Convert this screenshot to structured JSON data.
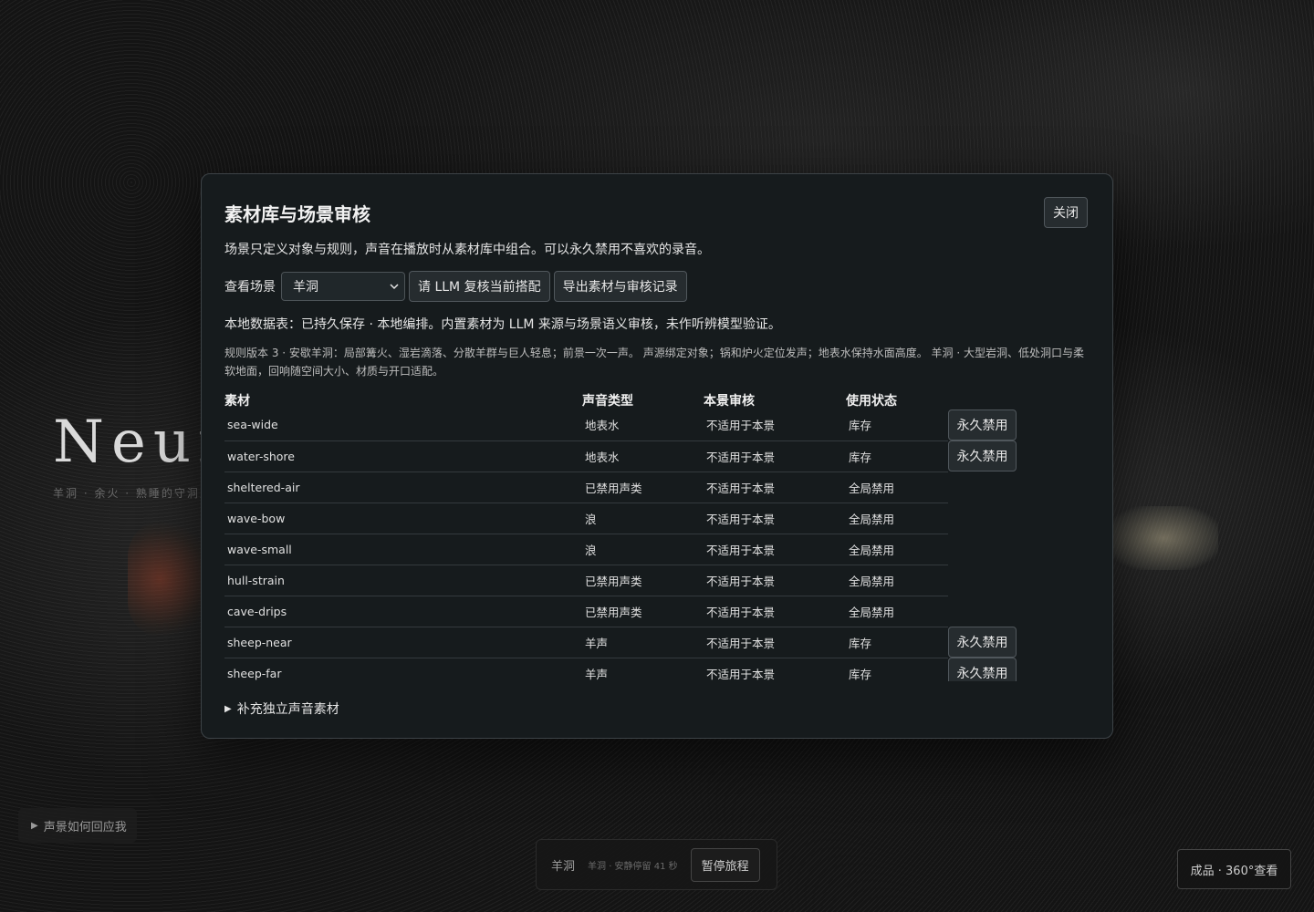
{
  "background": {
    "hero_title": "Neur",
    "hero_subtitle": "羊洞 · 余火 · 熟睡的守洞人",
    "help_toggle": "声景如何回应我",
    "player": {
      "scene": "羊洞",
      "status": "羊洞 · 安静停留 41 秒",
      "pause_label": "暂停旅程"
    },
    "view360_label": "成品 · 360°查看"
  },
  "modal": {
    "title": "素材库与场景审核",
    "close_label": "关闭",
    "description": "场景只定义对象与规则，声音在播放时从素材库中组合。可以永久禁用不喜欢的录音。",
    "scene_label": "查看场景",
    "scene_selected": "羊洞",
    "llm_review_label": "请 LLM 复核当前搭配",
    "export_label": "导出素材与审核记录",
    "storage_note": "本地数据表：已持久保存 · 本地编排。内置素材为 LLM 来源与场景语义审核，未作听辨模型验证。",
    "rules_note": "规则版本 3 · 安歇羊洞：局部篝火、湿岩滴落、分散羊群与巨人轻息；前景一次一声。 声源绑定对象；锅和炉火定位发声；地表水保持水面高度。 羊洞 · 大型岩洞、低处洞口与柔软地面，回响随空间大小、材质与开口适配。",
    "table": {
      "headers": [
        "素材",
        "声音类型",
        "本景审核",
        "使用状态"
      ],
      "ban_label": "永久禁用",
      "rows": [
        {
          "name": "sea-wide",
          "type": "地表水",
          "review": "不适用于本景",
          "status": "库存",
          "can_ban": true
        },
        {
          "name": "water-shore",
          "type": "地表水",
          "review": "不适用于本景",
          "status": "库存",
          "can_ban": true
        },
        {
          "name": "sheltered-air",
          "type": "已禁用声类",
          "review": "不适用于本景",
          "status": "全局禁用",
          "can_ban": false
        },
        {
          "name": "wave-bow",
          "type": "浪",
          "review": "不适用于本景",
          "status": "全局禁用",
          "can_ban": false
        },
        {
          "name": "wave-small",
          "type": "浪",
          "review": "不适用于本景",
          "status": "全局禁用",
          "can_ban": false
        },
        {
          "name": "hull-strain",
          "type": "已禁用声类",
          "review": "不适用于本景",
          "status": "全局禁用",
          "can_ban": false
        },
        {
          "name": "cave-drips",
          "type": "已禁用声类",
          "review": "不适用于本景",
          "status": "全局禁用",
          "can_ban": false
        },
        {
          "name": "sheep-near",
          "type": "羊声",
          "review": "不适用于本景",
          "status": "库存",
          "can_ban": true
        },
        {
          "name": "sheep-far",
          "type": "羊声",
          "review": "不适用于本景",
          "status": "库存",
          "can_ban": true
        }
      ]
    },
    "extra_label": "补充独立声音素材"
  }
}
